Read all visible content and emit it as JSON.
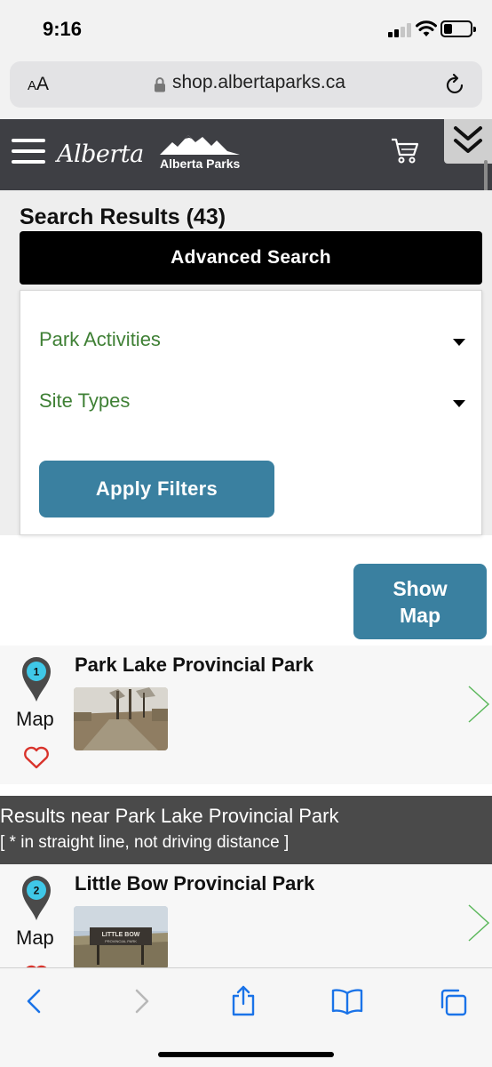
{
  "status_bar": {
    "time": "9:16"
  },
  "browser": {
    "text_size_label_small": "A",
    "text_size_label_large": "A",
    "url": "shop.albertaparks.ca"
  },
  "header": {
    "brand_script": "Alberta",
    "brand_parks": "Alberta Parks"
  },
  "search": {
    "results_title": "Search Results (43)",
    "advanced_search_label": "Advanced Search",
    "filters": [
      {
        "label": "Park Activities"
      },
      {
        "label": "Site Types"
      }
    ],
    "apply_label": "Apply Filters"
  },
  "show_map": {
    "line1": "Show",
    "line2": "Map"
  },
  "results": [
    {
      "pin_number": "1",
      "name": "Park Lake Provincial Park",
      "map_label": "Map"
    },
    {
      "pin_number": "2",
      "name": "Little Bow Provincial Park",
      "map_label": "Map",
      "sign_text_line1": "LITTLE BOW",
      "sign_text_line2": "PROVINCIAL PARK"
    }
  ],
  "nearby": {
    "title": "Results near Park Lake Provincial Park",
    "note": "[ * in straight line, not driving distance ]"
  },
  "colors": {
    "header_bg": "#3e3f44",
    "filter_text": "#3f8035",
    "button_blue": "#3a80a0",
    "pin_cyan": "#3fc8e8",
    "heart_red": "#d9332b",
    "chevron_green": "#5cb85c",
    "toolbar_blue": "#1a73e8"
  },
  "icons": [
    "hamburger-icon",
    "cart-icon",
    "double-chevron-down-icon",
    "lock-icon",
    "reload-icon",
    "map-pin-icon",
    "heart-icon",
    "chevron-right-icon",
    "back-icon",
    "forward-icon",
    "share-icon",
    "bookmarks-icon",
    "tabs-icon"
  ]
}
